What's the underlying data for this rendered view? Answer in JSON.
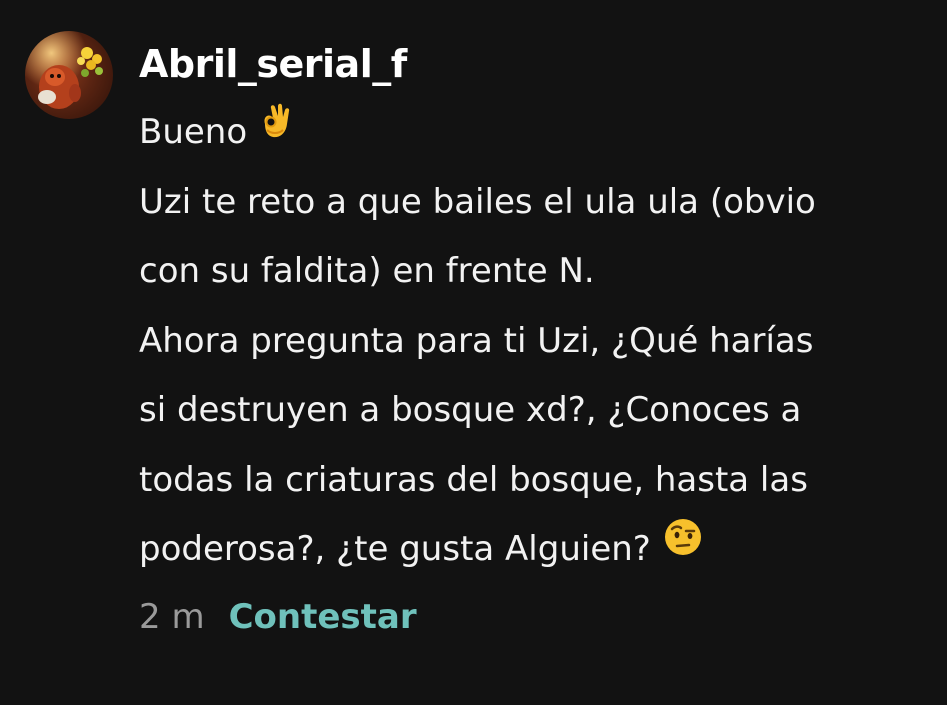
{
  "comment": {
    "username": "Abril_serial_f",
    "avatar_icon": "profile-avatar-icon",
    "lines": [
      {
        "text": "Bueno",
        "emoji": "ok-hand-emoji"
      },
      {
        "text": "Uzi te reto a que bailes el ula ula (obvio"
      },
      {
        "text": "con su faldita) en frente N."
      },
      {
        "text": "Ahora pregunta para ti Uzi, ¿Qué harías"
      },
      {
        "text": "si destruyen a bosque xd?, ¿Conoces a"
      },
      {
        "text": "todas la criaturas del bosque, hasta las"
      },
      {
        "text": "poderosa?, ¿te gusta Alguien?",
        "emoji": "raised-eyebrow-emoji"
      }
    ],
    "time": "2 m",
    "reply_label": "Contestar"
  },
  "colors": {
    "background": "#121212",
    "text": "#f2f2f2",
    "meta": "#9a9a9a",
    "accent": "#6fc1bb"
  }
}
